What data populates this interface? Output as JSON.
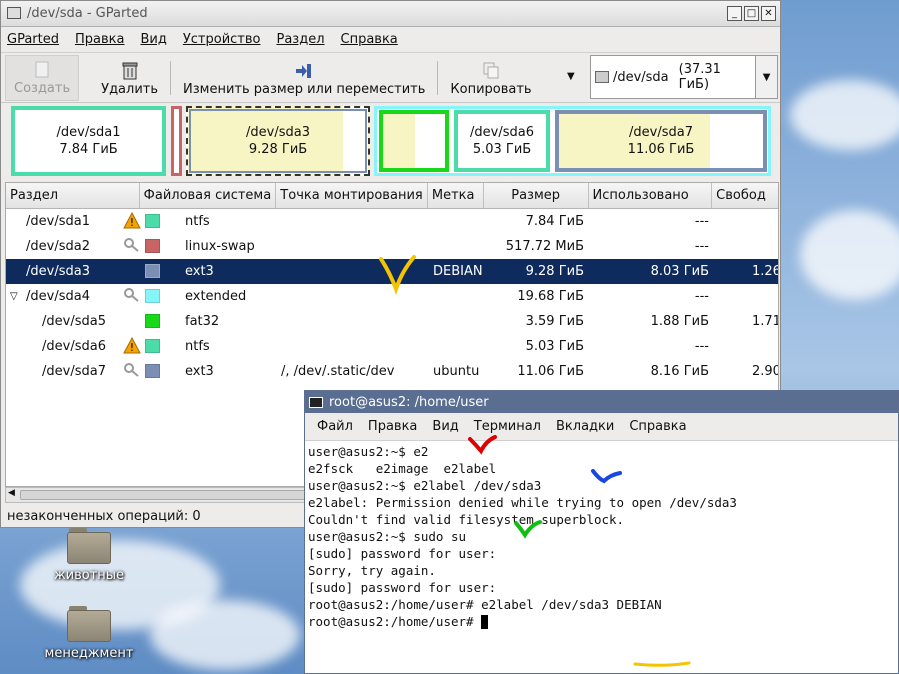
{
  "desktop": {
    "icons": [
      {
        "label": "животные",
        "icon": "folder-icon"
      },
      {
        "label": "менеджмент",
        "icon": "folder-icon"
      }
    ]
  },
  "gparted": {
    "title": "/dev/sda - GParted",
    "menu": [
      "GParted",
      "Правка",
      "Вид",
      "Устройство",
      "Раздел",
      "Справка"
    ],
    "toolbar": {
      "create": "Создать",
      "delete": "Удалить",
      "resize": "Изменить размер или переместить",
      "copy": "Копировать"
    },
    "device": {
      "name": "/dev/sda",
      "size": "(37.31 ГиБ)"
    },
    "map": [
      {
        "name": "/dev/sda1",
        "size": "7.84 ГиБ"
      },
      {
        "name": "/dev/sda3",
        "size": "9.28 ГиБ"
      },
      {
        "name": "/dev/sda6",
        "size": "5.03 ГиБ"
      },
      {
        "name": "/dev/sda7",
        "size": "11.06 ГиБ"
      }
    ],
    "columns": [
      "Раздел",
      "Файловая система",
      "Точка монтирования",
      "Метка",
      "Размер",
      "Использовано",
      "Свобод"
    ],
    "rows": [
      {
        "partition": "/dev/sda1",
        "fs": "ntfs",
        "mount": "",
        "label": "",
        "size": "7.84 ГиБ",
        "used": "---",
        "free": "",
        "color": "#4bdcaa",
        "status": "warning"
      },
      {
        "partition": "/dev/sda2",
        "fs": "linux-swap",
        "mount": "",
        "label": "",
        "size": "517.72 МиБ",
        "used": "---",
        "free": "",
        "color": "#c86464",
        "status": "key"
      },
      {
        "partition": "/dev/sda3",
        "fs": "ext3",
        "mount": "",
        "label": "DEBIAN",
        "size": "9.28 ГиБ",
        "used": "8.03 ГиБ",
        "free": "1.26",
        "color": "#7b8fb5",
        "status": "none"
      },
      {
        "partition": "/dev/sda4",
        "fs": "extended",
        "mount": "",
        "label": "",
        "size": "19.68 ГиБ",
        "used": "---",
        "free": "",
        "color": "#84f6fa",
        "status": "key"
      },
      {
        "partition": "/dev/sda5",
        "fs": "fat32",
        "mount": "",
        "label": "",
        "size": "3.59 ГиБ",
        "used": "1.88 ГиБ",
        "free": "1.71",
        "color": "#18d918",
        "status": "none"
      },
      {
        "partition": "/dev/sda6",
        "fs": "ntfs",
        "mount": "",
        "label": "",
        "size": "5.03 ГиБ",
        "used": "---",
        "free": "",
        "color": "#4bdcaa",
        "status": "warning"
      },
      {
        "partition": "/dev/sda7",
        "fs": "ext3",
        "mount": "/, /dev/.static/dev",
        "label": "ubuntu",
        "size": "11.06 ГиБ",
        "used": "8.16 ГиБ",
        "free": "2.90",
        "color": "#7b8fb5",
        "status": "key"
      }
    ],
    "status": "незаконченных операций: 0"
  },
  "terminal": {
    "title": "root@asus2: /home/user",
    "menu": [
      "Файл",
      "Правка",
      "Вид",
      "Терминал",
      "Вкладки",
      "Справка"
    ],
    "lines": [
      "user@asus2:~$ e2",
      "e2fsck   e2image  e2label",
      "user@asus2:~$ e2label /dev/sda3",
      "e2label: Permission denied while trying to open /dev/sda3",
      "Couldn't find valid filesystem superblock.",
      "user@asus2:~$ sudo su",
      "[sudo] password for user:",
      "Sorry, try again.",
      "[sudo] password for user:",
      "root@asus2:/home/user# e2label /dev/sda3 DEBIAN",
      "root@asus2:/home/user# "
    ]
  },
  "colors": {
    "selection": "#0f2a5c",
    "terminal_title": "#5a6e92",
    "ntfs": "#4bdcaa",
    "ext3": "#7b8fb5",
    "swap": "#c86464",
    "extended": "#84f6fa",
    "fat32": "#18d918"
  }
}
